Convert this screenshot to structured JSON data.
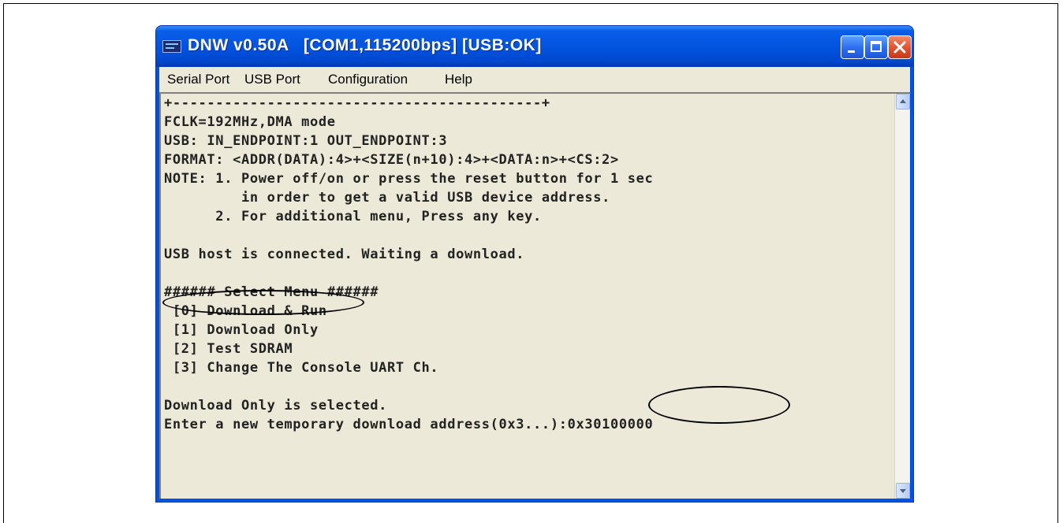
{
  "window": {
    "title": "DNW v0.50A   [COM1,115200bps] [USB:OK]",
    "controls": {
      "minimize_icon": "minimize-icon",
      "maximize_icon": "maximize-icon",
      "close_icon": "close-icon"
    }
  },
  "menubar": {
    "items": [
      {
        "label": "Serial Port"
      },
      {
        "label": "USB Port"
      },
      {
        "label": "Configuration"
      },
      {
        "label": "Help"
      }
    ]
  },
  "console": {
    "lines": [
      "+-------------------------------------------+",
      "FCLK=192MHz,DMA mode",
      "USB: IN_ENDPOINT:1 OUT_ENDPOINT:3",
      "FORMAT: <ADDR(DATA):4>+<SIZE(n+10):4>+<DATA:n>+<CS:2>",
      "NOTE: 1. Power off/on or press the reset button for 1 sec",
      "         in order to get a valid USB device address.",
      "      2. For additional menu, Press any key.",
      "",
      "USB host is connected. Waiting a download.",
      "",
      "###### Select Menu ######",
      " [0] Download & Run",
      " [1] Download Only",
      " [2] Test SDRAM",
      " [3] Change The Console UART Ch.",
      "",
      "Download Only is selected.",
      "Enter a new temporary download address(0x3...):0x30100000"
    ]
  },
  "colors": {
    "titlebar": "#0054e3",
    "client_bg": "#ece9d8",
    "close_button": "#e0502e",
    "text": "#222222"
  }
}
